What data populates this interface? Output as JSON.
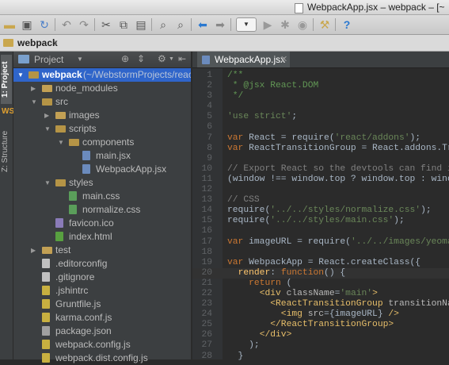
{
  "window": {
    "title": "WebpackApp.jsx – webpack – [~"
  },
  "toolbar": {
    "icons": [
      "folder-open-icon",
      "save-icon",
      "sync-icon",
      "undo-icon",
      "redo-icon",
      "cut-icon",
      "copy-icon",
      "paste-icon",
      "find-icon",
      "replace-icon",
      "back-icon",
      "forward-icon",
      "run-config-dropdown",
      "run-icon",
      "debug-icon",
      "stop-icon",
      "coverage-icon",
      "settings-icon",
      "help-icon"
    ]
  },
  "breadcrumb": {
    "label": "webpack"
  },
  "side_tabs": {
    "project": "1: Project",
    "structure": "Z: Structure"
  },
  "project_panel": {
    "dropdown": "Project",
    "tree": [
      {
        "label": "webpack",
        "sub": "(~/WebstormProjects/react",
        "depth": 0,
        "kind": "folder",
        "open": true,
        "selected": true
      },
      {
        "label": "node_modules",
        "depth": 1,
        "kind": "folder",
        "open": false
      },
      {
        "label": "src",
        "depth": 1,
        "kind": "folder",
        "open": true
      },
      {
        "label": "images",
        "depth": 2,
        "kind": "folder",
        "open": false
      },
      {
        "label": "scripts",
        "depth": 2,
        "kind": "folder",
        "open": true
      },
      {
        "label": "components",
        "depth": 3,
        "kind": "folder",
        "open": true
      },
      {
        "label": "main.jsx",
        "depth": 4,
        "kind": "jsx"
      },
      {
        "label": "WebpackApp.jsx",
        "depth": 4,
        "kind": "jsx"
      },
      {
        "label": "styles",
        "depth": 2,
        "kind": "folder",
        "open": true
      },
      {
        "label": "main.css",
        "depth": 3,
        "kind": "css"
      },
      {
        "label": "normalize.css",
        "depth": 3,
        "kind": "css"
      },
      {
        "label": "favicon.ico",
        "depth": 2,
        "kind": "ico"
      },
      {
        "label": "index.html",
        "depth": 2,
        "kind": "html"
      },
      {
        "label": "test",
        "depth": 1,
        "kind": "folder",
        "open": false
      },
      {
        "label": ".editorconfig",
        "depth": 1,
        "kind": "text"
      },
      {
        "label": ".gitignore",
        "depth": 1,
        "kind": "text"
      },
      {
        "label": ".jshintrc",
        "depth": 1,
        "kind": "js"
      },
      {
        "label": "Gruntfile.js",
        "depth": 1,
        "kind": "js"
      },
      {
        "label": "karma.conf.js",
        "depth": 1,
        "kind": "js"
      },
      {
        "label": "package.json",
        "depth": 1,
        "kind": "json"
      },
      {
        "label": "webpack.config.js",
        "depth": 1,
        "kind": "js"
      },
      {
        "label": "webpack.dist.config.js",
        "depth": 1,
        "kind": "js"
      }
    ]
  },
  "editor": {
    "tab_label": "WebpackApp.jsx",
    "lines": [
      {
        "n": "1",
        "spans": [
          [
            "c-doc",
            "/**"
          ]
        ]
      },
      {
        "n": "2",
        "spans": [
          [
            "c-doc",
            " * @jsx React.DOM"
          ]
        ]
      },
      {
        "n": "3",
        "spans": [
          [
            "c-doc",
            " */"
          ]
        ]
      },
      {
        "n": "4",
        "spans": []
      },
      {
        "n": "5",
        "spans": [
          [
            "c-str",
            "'use strict'"
          ],
          [
            "",
            ";"
          ]
        ]
      },
      {
        "n": "6",
        "spans": []
      },
      {
        "n": "7",
        "spans": [
          [
            "c-kw",
            "var "
          ],
          [
            "",
            "React = require("
          ],
          [
            "c-str",
            "'react/addons'"
          ],
          [
            "",
            ");"
          ]
        ]
      },
      {
        "n": "8",
        "spans": [
          [
            "c-kw",
            "var "
          ],
          [
            "",
            "ReactTransitionGroup = React.addons.Trans"
          ]
        ]
      },
      {
        "n": "9",
        "spans": []
      },
      {
        "n": "10",
        "spans": [
          [
            "c-com",
            "// Export React so the devtools can find it"
          ]
        ]
      },
      {
        "n": "11",
        "spans": [
          [
            "",
            "(window !== window.top ? window.top : window)"
          ]
        ]
      },
      {
        "n": "12",
        "spans": []
      },
      {
        "n": "13",
        "spans": [
          [
            "c-com",
            "// CSS"
          ]
        ]
      },
      {
        "n": "14",
        "spans": [
          [
            "",
            "require("
          ],
          [
            "c-str",
            "'../../styles/normalize.css'"
          ],
          [
            "",
            ");"
          ]
        ]
      },
      {
        "n": "15",
        "spans": [
          [
            "",
            "require("
          ],
          [
            "c-str",
            "'../../styles/main.css'"
          ],
          [
            "",
            ");"
          ]
        ]
      },
      {
        "n": "16",
        "spans": []
      },
      {
        "n": "17",
        "spans": [
          [
            "c-kw",
            "var "
          ],
          [
            "",
            "imageURL = require("
          ],
          [
            "c-str",
            "'../../images/yeoman.p"
          ]
        ]
      },
      {
        "n": "18",
        "spans": []
      },
      {
        "n": "19",
        "spans": [
          [
            "c-kw",
            "var "
          ],
          [
            "",
            "WebpackApp = React.createClass({"
          ]
        ]
      },
      {
        "n": "20",
        "spans": [
          [
            "",
            "  "
          ],
          [
            "c-fn",
            "render"
          ],
          [
            "",
            ": "
          ],
          [
            "c-kw",
            "function"
          ],
          [
            "",
            "() {"
          ]
        ]
      },
      {
        "n": "21",
        "spans": [
          [
            "",
            "    "
          ],
          [
            "c-kw",
            "return "
          ],
          [
            "",
            "("
          ]
        ]
      },
      {
        "n": "22",
        "spans": [
          [
            "",
            "      "
          ],
          [
            "c-tag",
            "<div "
          ],
          [
            "c-attr",
            "className"
          ],
          [
            "",
            "="
          ],
          [
            "c-str",
            "'main'"
          ],
          [
            "c-tag",
            ">"
          ]
        ]
      },
      {
        "n": "23",
        "spans": [
          [
            "",
            "        "
          ],
          [
            "c-tag",
            "<ReactTransitionGroup "
          ],
          [
            "c-attr",
            "transitionName="
          ]
        ]
      },
      {
        "n": "24",
        "spans": [
          [
            "",
            "          "
          ],
          [
            "c-tag",
            "<img "
          ],
          [
            "c-attr",
            "src"
          ],
          [
            "",
            "={imageURL} "
          ],
          [
            "c-tag",
            "/>"
          ]
        ]
      },
      {
        "n": "25",
        "spans": [
          [
            "",
            "        "
          ],
          [
            "c-tag",
            "</ReactTransitionGroup>"
          ]
        ]
      },
      {
        "n": "26",
        "spans": [
          [
            "",
            "      "
          ],
          [
            "c-tag",
            "</div>"
          ]
        ]
      },
      {
        "n": "27",
        "spans": [
          [
            "",
            "    );"
          ]
        ]
      },
      {
        "n": "28",
        "spans": [
          [
            "",
            "  }"
          ]
        ]
      }
    ],
    "current_line": 20
  },
  "colors": {
    "accent": "#2f65ca",
    "editor_bg": "#2b2b2b",
    "panel_bg": "#3c3f41"
  }
}
